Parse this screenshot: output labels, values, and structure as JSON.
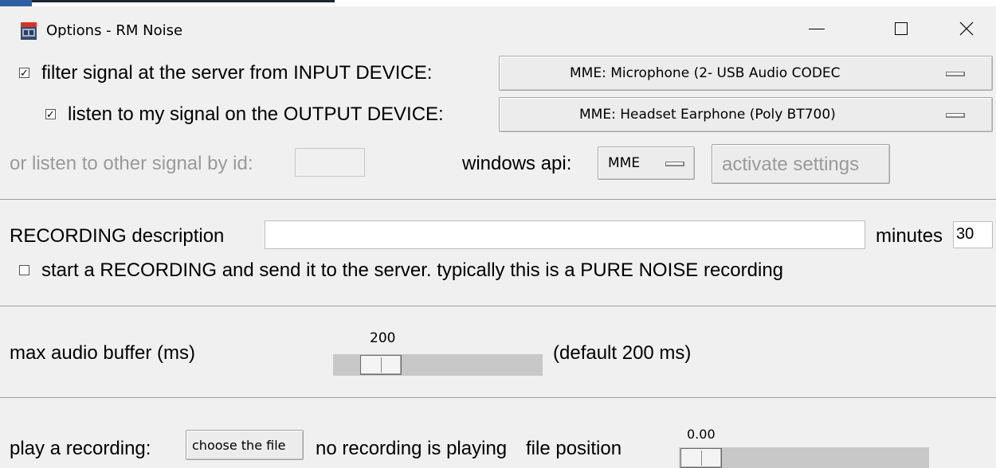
{
  "window": {
    "title": "Options - RM Noise",
    "controls": {
      "minimize": "—",
      "maximize": "☐",
      "close": "✕"
    }
  },
  "input_device": {
    "checked": true,
    "label": "filter signal at the server from INPUT DEVICE:",
    "selected": "MME:  Microphone (2- USB Audio CODEC"
  },
  "output_device": {
    "checked": true,
    "label": "listen to my signal on the OUTPUT DEVICE:",
    "selected": "MME:  Headset Earphone (Poly BT700)"
  },
  "other_signal": {
    "label": "or listen to other signal by id:",
    "value": ""
  },
  "api": {
    "label": "windows api:",
    "selected": "MME",
    "activate_label": "activate settings"
  },
  "recording": {
    "description_label": "RECORDING description",
    "description_value": "",
    "minutes_label": "minutes",
    "minutes_value": "30",
    "start_checked": false,
    "start_label": "start a RECORDING and send it to the server.  typically this is a PURE NOISE recording"
  },
  "buffer": {
    "label": "max audio buffer (ms)",
    "value": "200",
    "value_num": 200,
    "default_label": "(default 200 ms)"
  },
  "playback": {
    "label": "play a recording:",
    "choose_label": "choose the file",
    "status": "no recording is playing",
    "position_label": "file position",
    "position_value": "0.00",
    "position_num": 0
  },
  "colors": {
    "background": "#f0f0f0",
    "disabled_text": "#9a9a9a",
    "separator": "#a0a0a0"
  }
}
